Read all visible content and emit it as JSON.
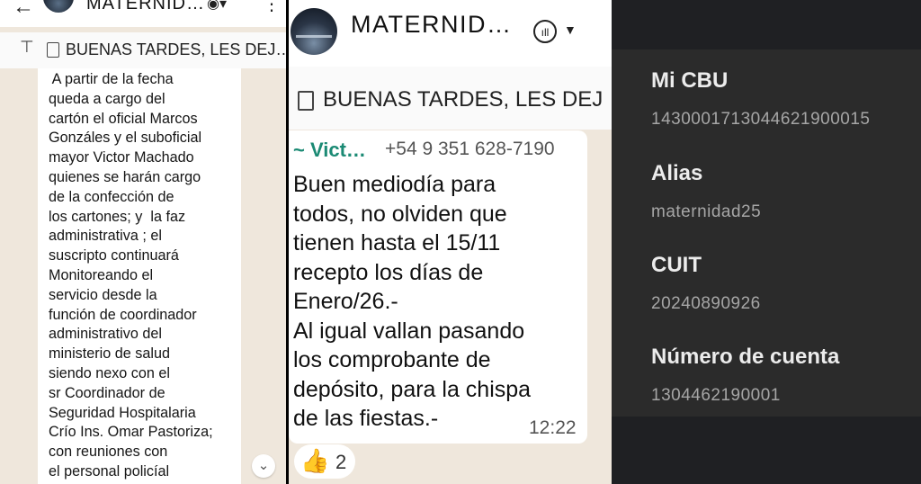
{
  "left": {
    "title": "MATERNID…",
    "pinned": "BUENAS TARDES, LES DEJ…",
    "message": " A partir de la fecha\nqueda a cargo del\ncartón el oficial Marcos\nGonzáles y el suboficial\nmayor Victor Machado\nquienes se harán cargo\nde la confección de\nlos cartones; y  la faz\nadministrativa ; el\nsuscripto continuará\nMonitoreando el\nservicio desde la\nfunción de coordinador\nadministrativo del\nministerio de salud\nsiendo nexo con el\nsr Coordinador de\nSeguridad Hospitalaria\nCrío Ins. Omar Pastoriza;\ncon reuniones con\nel personal policíal"
  },
  "middle": {
    "title": "MATERNID…",
    "pinned": "BUENAS TARDES, LES DEJ",
    "sender": "~ Vict…",
    "phone": "+54 9 351 628-7190",
    "message": "Buen mediodía para\ntodos, no olviden que\ntienen hasta el 15/11\nrecepto los días de\nEnero/26.-\nAl igual vallan pasando\nlos comprobante de\ndepósito, para la chispa\nde las fiestas.-",
    "time": "12:22",
    "reaction_count": "2"
  },
  "right": {
    "fields": [
      {
        "label": "Mi CBU",
        "value": "1430001713044621900015"
      },
      {
        "label": "Alias",
        "value": "maternidad25"
      },
      {
        "label": "CUIT",
        "value": "20240890926"
      },
      {
        "label": "Número de cuenta",
        "value": "1304462190001"
      }
    ]
  }
}
